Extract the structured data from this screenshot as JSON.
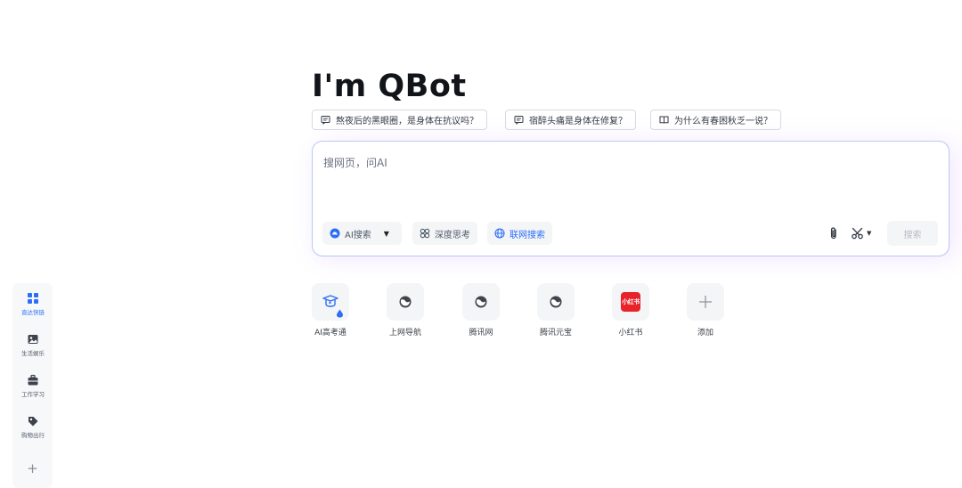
{
  "hero": {
    "title": "I'm QBot"
  },
  "suggestions": [
    {
      "label": "熬夜后的黑眼圈，是身体在抗议吗？",
      "icon": "chat-bubble-icon"
    },
    {
      "label": "宿醉头痛是身体在修复？",
      "icon": "chat-bubble-icon"
    },
    {
      "label": "为什么有春困秋乏一说？",
      "icon": "book-icon"
    }
  ],
  "search": {
    "placeholder": "搜网页，问AI",
    "mode_label": "AI搜索",
    "deep_think_label": "深度思考",
    "web_search_label": "联网搜索",
    "submit_label": "搜索"
  },
  "quick_links": [
    {
      "label": "AI高考通",
      "icon": "graduation-cap-icon"
    },
    {
      "label": "上网导航",
      "icon": "globe-icon"
    },
    {
      "label": "腾讯网",
      "icon": "globe-icon"
    },
    {
      "label": "腾讯元宝",
      "icon": "globe-icon"
    },
    {
      "label": "小红书",
      "icon": "xiaohongshu-logo",
      "logo_text": "小红书"
    },
    {
      "label": "添加",
      "icon": "plus-icon"
    }
  ],
  "sidebar": {
    "items": [
      {
        "label": "直达快链",
        "icon": "grid-icon",
        "active": true
      },
      {
        "label": "生活娱乐",
        "icon": "image-icon",
        "active": false
      },
      {
        "label": "工作学习",
        "icon": "briefcase-icon",
        "active": false
      },
      {
        "label": "购物出行",
        "icon": "tag-icon",
        "active": false
      }
    ],
    "add_label": "+"
  },
  "colors": {
    "accent": "#2b6ef7",
    "search_border": "#b9c7f5",
    "xiaohongshu_red": "#e8232a"
  }
}
